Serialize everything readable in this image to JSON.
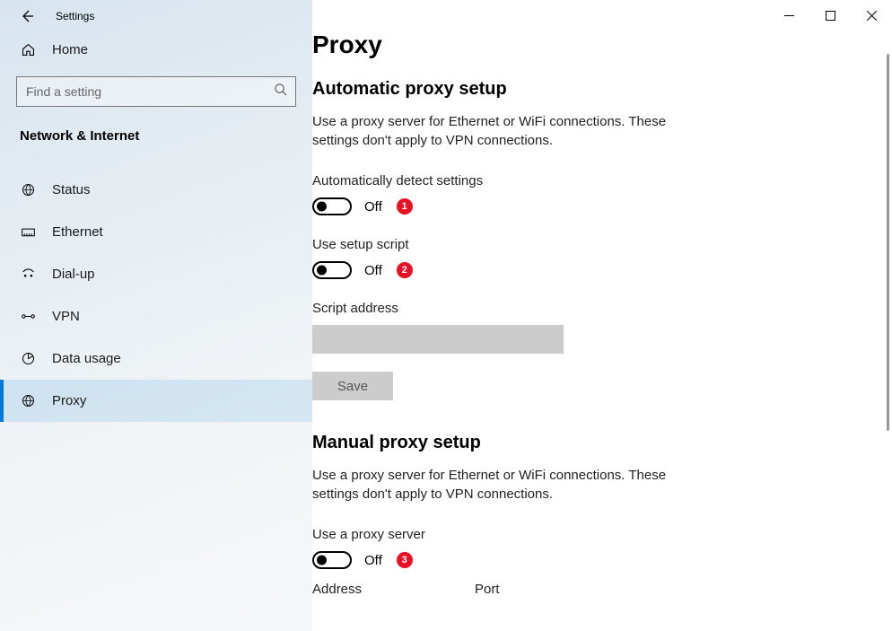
{
  "app_title": "Settings",
  "search": {
    "placeholder": "Find a setting"
  },
  "sidebar": {
    "home": "Home",
    "category": "Network & Internet",
    "items": [
      {
        "label": "Status"
      },
      {
        "label": "Ethernet"
      },
      {
        "label": "Dial-up"
      },
      {
        "label": "VPN"
      },
      {
        "label": "Data usage"
      },
      {
        "label": "Proxy"
      }
    ]
  },
  "page": {
    "title": "Proxy",
    "auto": {
      "heading": "Automatic proxy setup",
      "desc": "Use a proxy server for Ethernet or WiFi connections. These settings don't apply to VPN connections.",
      "detect_label": "Automatically detect settings",
      "detect_state": "Off",
      "detect_annot": "1",
      "script_label": "Use setup script",
      "script_state": "Off",
      "script_annot": "2",
      "script_addr_label": "Script address",
      "script_addr_value": "",
      "save_label": "Save"
    },
    "manual": {
      "heading": "Manual proxy setup",
      "desc": "Use a proxy server for Ethernet or WiFi connections. These settings don't apply to VPN connections.",
      "use_label": "Use a proxy server",
      "use_state": "Off",
      "use_annot": "3",
      "address_label": "Address",
      "port_label": "Port"
    }
  }
}
